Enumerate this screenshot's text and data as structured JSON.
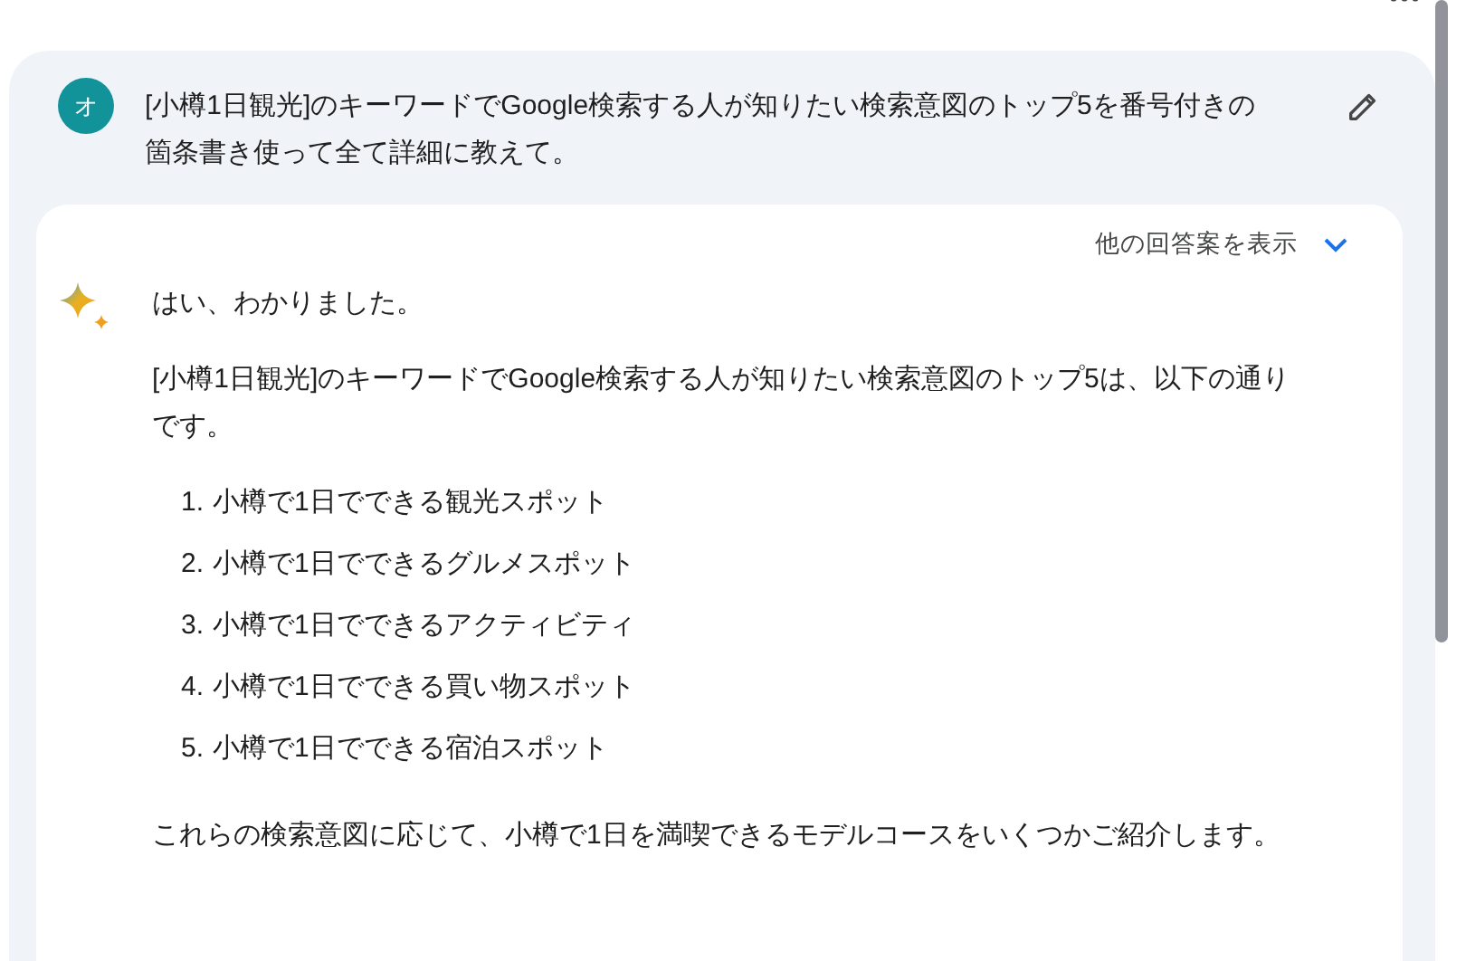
{
  "prompt": {
    "avatar": "オ",
    "text": "[小樽1日観光]のキーワードでGoogle検索する人が知りたい検索意図のトップ5を番号付きの箇条書き使って全て詳細に教えて。"
  },
  "response": {
    "drafts_label": "他の回答案を表示",
    "intro": "はい、わかりました。",
    "lead": "[小樽1日観光]のキーワードでGoogle検索する人が知りたい検索意図のトップ5は、以下の通りです。",
    "items": [
      {
        "number": "1.",
        "text": "小樽で1日でできる観光スポット"
      },
      {
        "number": "2.",
        "text": "小樽で1日でできるグルメスポット"
      },
      {
        "number": "3.",
        "text": "小樽で1日でできるアクティビティ"
      },
      {
        "number": "4.",
        "text": "小樽で1日でできる買い物スポット"
      },
      {
        "number": "5.",
        "text": "小樽で1日でできる宿泊スポット"
      }
    ],
    "outro": "これらの検索意図に応じて、小樽で1日を満喫できるモデルコースをいくつかご紹介します。"
  }
}
